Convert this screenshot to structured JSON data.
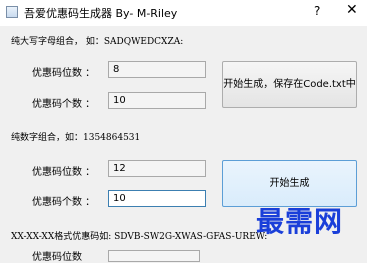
{
  "window": {
    "title": "吾爱优惠码生成器 By- M-Riley",
    "help": "?",
    "close": "✕"
  },
  "section1": {
    "heading": "纯大写字母组合， 如：SADQWEDCXZA:",
    "length_label": "优惠码位数 ：",
    "length_value": "8",
    "count_label": "优惠码个数 ：",
    "count_value": "10",
    "button": "开始生成，保存在Code.txt中"
  },
  "section2": {
    "heading": "纯数字组合，如：1354864531",
    "length_label": "优惠码位数 ：",
    "length_value": "12",
    "count_label": "优惠码个数 ：",
    "count_value": "10",
    "button": "开始生成"
  },
  "section3": {
    "heading": "XX-XX-XX格式优惠码如: SDVB-SW2G-XWAS-GFAS-UREW:",
    "partial_label": "优惠码位数"
  },
  "watermark": "最需网"
}
